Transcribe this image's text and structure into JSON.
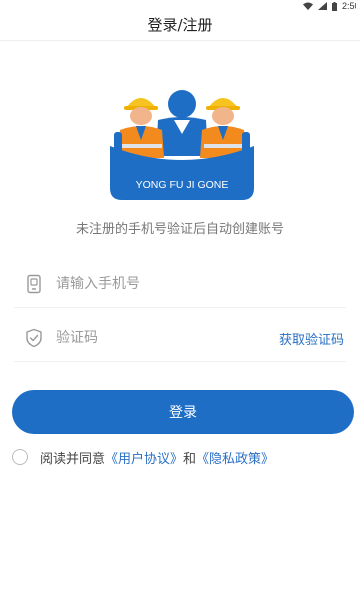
{
  "status_bar": {
    "time": "2:50",
    "icons": [
      "wifi-icon",
      "signal-icon",
      "battery-icon"
    ]
  },
  "header": {
    "title": "登录/注册"
  },
  "logo": {
    "text": "YONG FU JI GONE",
    "colors": {
      "blue": "#1f6ec5",
      "orange": "#f28a1e",
      "yellow": "#f7c321",
      "skin": "#f2b48a"
    }
  },
  "tagline": "未注册的手机号验证后自动创建账号",
  "form": {
    "phone_placeholder": "请输入手机号",
    "phone_icon": "phone-icon",
    "code_placeholder": "验证码",
    "code_icon": "shield-icon",
    "get_code_label": "获取验证码"
  },
  "login_button_label": "登录",
  "agreement": {
    "prefix": "阅读并同意",
    "user_agreement": "《用户协议》",
    "and": "和",
    "privacy_policy": "《隐私政策》"
  },
  "colors": {
    "accent": "#1f6ec5",
    "link": "#2a6fc6"
  }
}
